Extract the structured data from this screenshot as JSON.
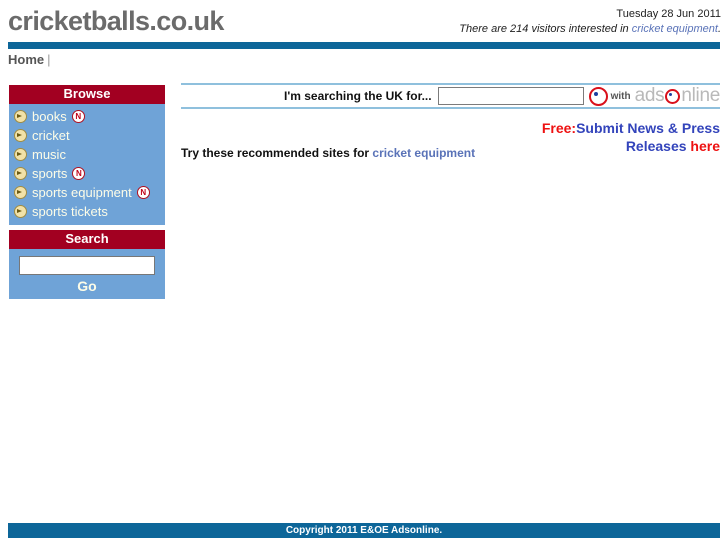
{
  "header": {
    "logo": "cricketballs.co.uk",
    "date": "Tuesday 28 Jun 2011",
    "visitors_prefix": "There are 214 visitors interested in ",
    "visitors_link": "cricket equipment",
    "visitors_suffix": "."
  },
  "breadcrumb": {
    "home": "Home",
    "separator": "|"
  },
  "sidebar": {
    "browse": {
      "title": "Browse",
      "items": [
        {
          "label": "books",
          "badge": "N"
        },
        {
          "label": "cricket",
          "badge": ""
        },
        {
          "label": "music",
          "badge": ""
        },
        {
          "label": "sports",
          "badge": "N"
        },
        {
          "label": "sports equipment",
          "badge": "N"
        },
        {
          "label": "sports tickets",
          "badge": ""
        }
      ]
    },
    "search": {
      "title": "Search",
      "input_value": "",
      "input_placeholder": "",
      "go_label": "Go"
    }
  },
  "main": {
    "searchbar": {
      "label": "I'm searching the UK for...",
      "input_value": "",
      "input_placeholder": "",
      "with_label": "with",
      "brand_part1": "ads",
      "brand_part2": "nline"
    },
    "recommend": {
      "prefix": "Try these recommended sites for ",
      "link": "cricket equipment"
    },
    "promo": {
      "free": "Free:",
      "line1": "Submit News & Press",
      "line2": "Releases ",
      "here": "here"
    }
  },
  "footer": {
    "copyright": "Copyright 2011 E&OE Adsonline."
  },
  "colors": {
    "header_rule": "#0d6699",
    "panel_title_bg": "#a20021",
    "panel_body_bg": "#6fa3d7",
    "link_blue": "#5a73b8",
    "promo_red": "#ee1111",
    "promo_blue": "#3344bb",
    "footer_bg": "#0d6699"
  }
}
